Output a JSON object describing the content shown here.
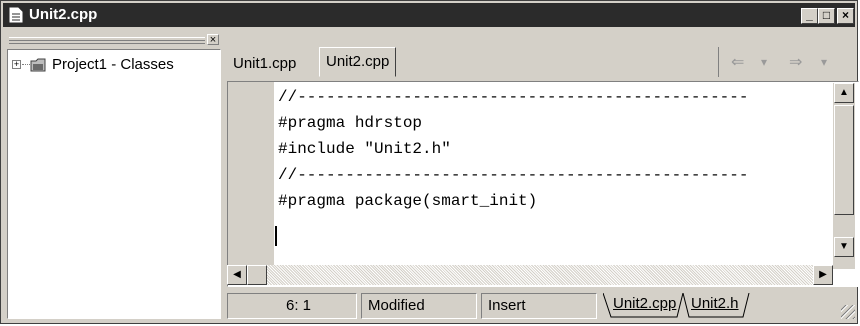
{
  "window": {
    "title": "Unit2.cpp"
  },
  "title_buttons": {
    "minimize": "_",
    "maximize": "□",
    "close": "×"
  },
  "left_panel": {
    "close_glyph": "×",
    "tree": [
      {
        "expander": "+",
        "icon": "folder-icon",
        "label": "Project1 - Classes"
      }
    ]
  },
  "tabs": [
    {
      "label": "Unit1.cpp",
      "active": false
    },
    {
      "label": "Unit2.cpp",
      "active": true
    }
  ],
  "nav": {
    "back": "⇐",
    "back_drop": "▾",
    "forward": "⇒",
    "forward_drop": "▾"
  },
  "code_lines": [
    "//-----------------------------------------------",
    "#pragma hdrstop",
    "#include \"Unit2.h\"",
    "//-----------------------------------------------",
    "#pragma package(smart_init)",
    ""
  ],
  "scroll": {
    "up": "▲",
    "down": "▼",
    "left": "◀",
    "right": "▶"
  },
  "status": {
    "position": "6:  1",
    "modified": "Modified",
    "mode": "Insert",
    "file_tabs": [
      "Unit2.cpp",
      "Unit2.h"
    ]
  }
}
